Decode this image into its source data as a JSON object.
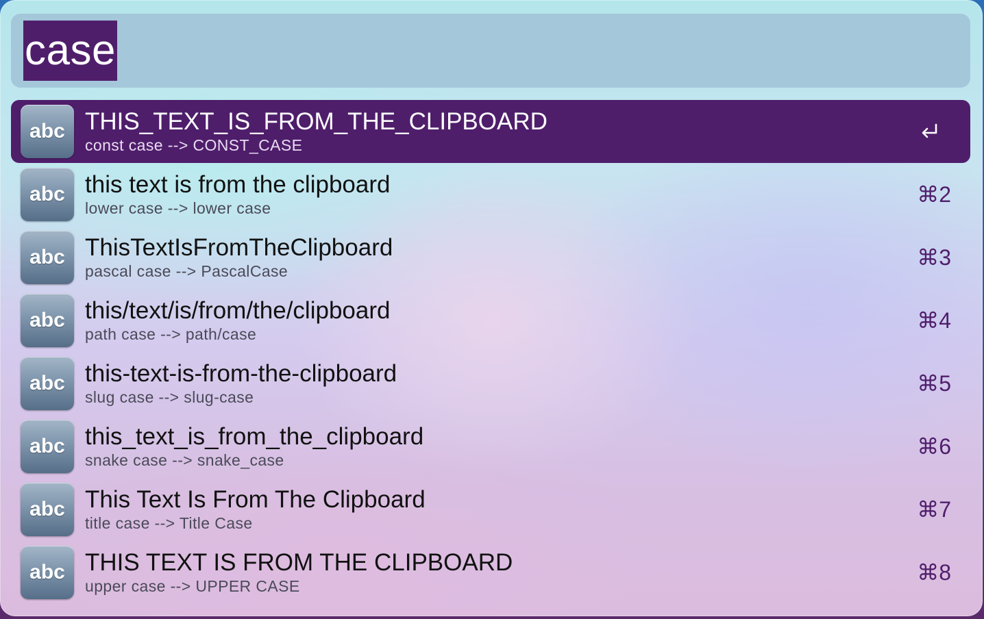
{
  "search": {
    "query": "case"
  },
  "results": [
    {
      "icon_text": "abc",
      "icon_name": "text-icon",
      "title": "THIS_TEXT_IS_FROM_THE_CLIPBOARD",
      "subtitle": "const case --> CONST_CASE",
      "shortcut": "",
      "action_icon": "return-icon",
      "selected": true
    },
    {
      "icon_text": "abc",
      "icon_name": "text-icon",
      "title": "this text is from the clipboard",
      "subtitle": "lower case --> lower case",
      "shortcut": "⌘2",
      "selected": false
    },
    {
      "icon_text": "abc",
      "icon_name": "text-icon",
      "title": "ThisTextIsFromTheClipboard",
      "subtitle": "pascal case --> PascalCase",
      "shortcut": "⌘3",
      "selected": false
    },
    {
      "icon_text": "abc",
      "icon_name": "text-icon",
      "title": "this/text/is/from/the/clipboard",
      "subtitle": "path case --> path/case",
      "shortcut": "⌘4",
      "selected": false
    },
    {
      "icon_text": "abc",
      "icon_name": "text-icon",
      "title": "this-text-is-from-the-clipboard",
      "subtitle": "slug case --> slug-case",
      "shortcut": "⌘5",
      "selected": false
    },
    {
      "icon_text": "abc",
      "icon_name": "text-icon",
      "title": "this_text_is_from_the_clipboard",
      "subtitle": "snake case --> snake_case",
      "shortcut": "⌘6",
      "selected": false
    },
    {
      "icon_text": "abc",
      "icon_name": "text-icon",
      "title": "This Text Is From The Clipboard",
      "subtitle": "title case --> Title Case",
      "shortcut": "⌘7",
      "selected": false
    },
    {
      "icon_text": "abc",
      "icon_name": "text-icon",
      "title": "THIS TEXT IS FROM THE CLIPBOARD",
      "subtitle": "upper case --> UPPER CASE",
      "shortcut": "⌘8",
      "selected": false
    }
  ],
  "colors": {
    "accent": "#4f1e6b",
    "search_bar": "#a0c0d6"
  }
}
